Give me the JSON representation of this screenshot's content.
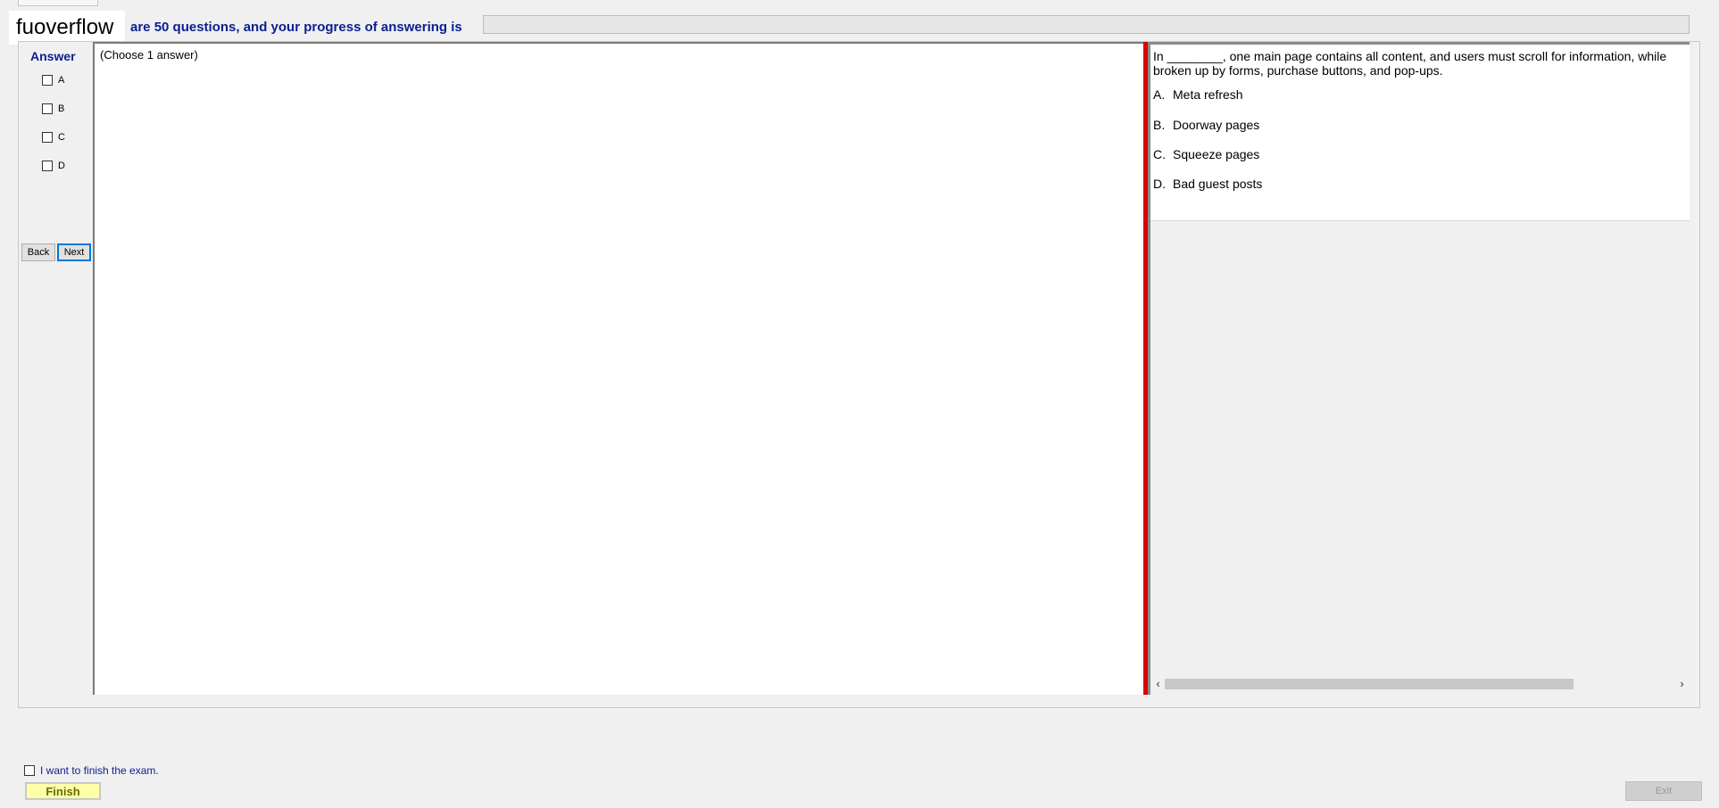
{
  "brand": "fuoverflow",
  "header": {
    "text": "are 50 questions, and your progress of answering is",
    "progress_fraction": 0
  },
  "answer_panel": {
    "title": "Answer",
    "options": [
      "A",
      "B",
      "C",
      "D"
    ],
    "back_label": "Back",
    "next_label": "Next"
  },
  "work_pane": {
    "instruction": "(Choose 1 answer)"
  },
  "question": {
    "text": "In ________, one main page contains all content, and users must scroll for information, while broken up by forms, purchase buttons, and pop-ups.",
    "choices": [
      {
        "letter": "A.",
        "text": "Meta refresh"
      },
      {
        "letter": "B.",
        "text": "Doorway pages"
      },
      {
        "letter": "C.",
        "text": "Squeeze pages"
      },
      {
        "letter": "D.",
        "text": "Bad guest posts"
      }
    ]
  },
  "footer": {
    "finish_check_label": "I want to finish the exam.",
    "finish_label": "Finish",
    "exit_label": "Exit"
  },
  "colors": {
    "accent_text": "#0a1f8f",
    "separator": "#d90000",
    "finish_button": "#ffffa8"
  }
}
